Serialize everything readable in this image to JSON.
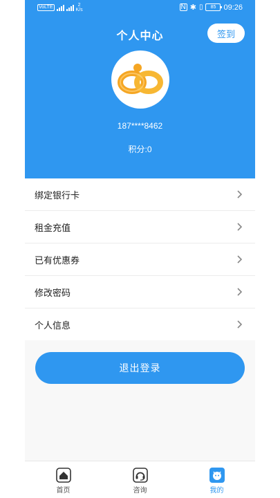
{
  "status": {
    "network_chip": "VoLTE",
    "speed_value": "2",
    "speed_unit": "K/s",
    "battery": "85",
    "time": "09:26"
  },
  "header": {
    "title": "个人中心",
    "signin_label": "签到",
    "phone": "187****8462",
    "points": "积分:0"
  },
  "menu": {
    "items": [
      {
        "label": "绑定银行卡",
        "icon": "chevron-right-icon"
      },
      {
        "label": "租金充值",
        "icon": "chevron-right-icon"
      },
      {
        "label": "已有优惠券",
        "icon": "chevron-right-icon"
      },
      {
        "label": "修改密码",
        "icon": "chevron-right-icon"
      },
      {
        "label": "个人信息",
        "icon": "chevron-right-icon"
      }
    ]
  },
  "logout_label": "退出登录",
  "tabbar": {
    "tabs": [
      {
        "label": "首页",
        "icon": "home-icon"
      },
      {
        "label": "咨询",
        "icon": "headset-icon"
      },
      {
        "label": "我的",
        "icon": "profile-face-icon",
        "active": true
      }
    ]
  },
  "colors": {
    "primary": "#2f97f0",
    "background": "#f8f8f8",
    "logo_gold": "#f5a623"
  }
}
